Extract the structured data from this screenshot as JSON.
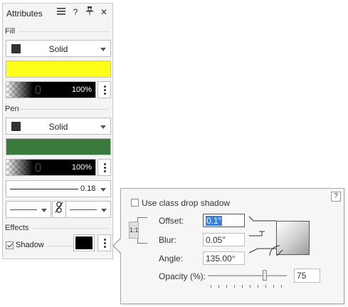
{
  "panel": {
    "title": "Attributes",
    "header_icons": [
      "menu-icon",
      "help-icon",
      "pin-icon",
      "close-icon"
    ],
    "help_glyph": "?",
    "close_glyph": "✕",
    "fill": {
      "label": "Fill",
      "style": "Solid",
      "color": "#ffff1a",
      "opacity": "100%"
    },
    "pen": {
      "label": "Pen",
      "style": "Solid",
      "color": "#3a7a3c",
      "opacity": "100%",
      "weight": "0.18"
    },
    "effects": {
      "label": "Effects",
      "shadow_label": "Shadow",
      "shadow_checked": true,
      "shadow_color": "#000000"
    }
  },
  "shadow_popup": {
    "use_class_label": "Use class drop shadow",
    "use_class_checked": false,
    "help_glyph": "?",
    "ratio_label": "1:1",
    "offset_label": "Offset:",
    "offset_value": "0.1\"",
    "blur_label": "Blur:",
    "blur_value": "0.05\"",
    "angle_label": "Angle:",
    "angle_value": "135.00°",
    "opacity_label": "Opacity (%):",
    "opacity_value": "75"
  }
}
